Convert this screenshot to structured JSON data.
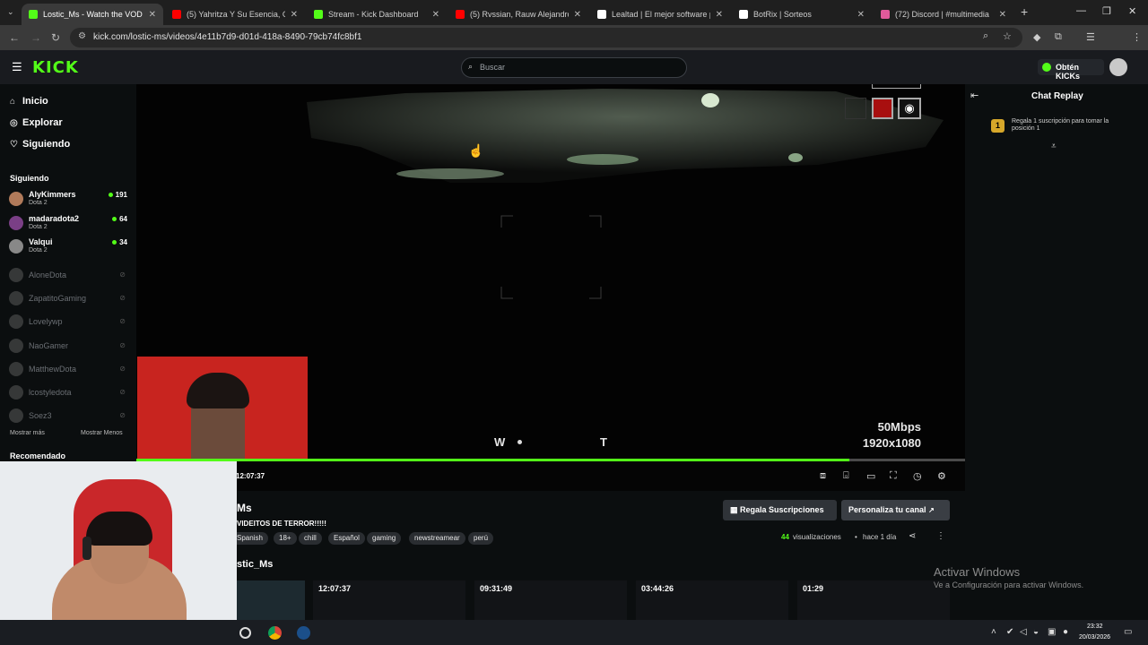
{
  "browser": {
    "tabs": [
      {
        "label": "Lostic_Ms - Watch the VOD on",
        "color": "#53fc18",
        "active": true
      },
      {
        "label": "(5) Yahritza Y Su Esencia, Grupo",
        "color": "#ff0000"
      },
      {
        "label": "Stream - Kick Dashboard",
        "color": "#53fc18"
      },
      {
        "label": "(5) Rvssian, Rauw Alejandro & L",
        "color": "#ff0000"
      },
      {
        "label": "Lealtad | El mejor software para",
        "color": "#ffffff"
      },
      {
        "label": "BotRix | Sorteos",
        "color": "#ffffff"
      },
      {
        "label": "(72) Discord | #multimedia",
        "color": "#e05a9b"
      }
    ],
    "new_tab": "+",
    "url": "kick.com/lostic-ms/videos/4e11b7d9-d01d-418a-8490-79cb74fc8bf1"
  },
  "header": {
    "logo": "KICK",
    "search_placeholder": "Buscar",
    "kicks_button": "Obtén KICKs"
  },
  "sidebar": {
    "nav": [
      {
        "label": "Inicio",
        "icon": "home-icon",
        "glyph": "⌂"
      },
      {
        "label": "Explorar",
        "icon": "compass-icon",
        "glyph": "◎"
      },
      {
        "label": "Siguiendo",
        "icon": "heart-icon",
        "glyph": "♡"
      }
    ],
    "following_heading": "Siguiendo",
    "live_channels": [
      {
        "name": "AlyKimmers",
        "game": "Dota 2",
        "viewers": "191",
        "color": "#b07a5a"
      },
      {
        "name": "madaradota2",
        "game": "Dota 2",
        "viewers": "64",
        "color": "#7a3f86"
      },
      {
        "name": "Valqui",
        "game": "Dota 2",
        "viewers": "34",
        "color": "#888888"
      }
    ],
    "offline_channels": [
      "AloneDota",
      "ZapatitoGaming",
      "Lovelywp",
      "NaoGamer",
      "MatthewDota",
      "lcostyledota",
      "Soez3"
    ],
    "show_more": "Mostrar más",
    "show_less": "Mostrar Menos",
    "recommended_heading": "Recomendado"
  },
  "video": {
    "bitrate": "50Mbps",
    "resolution": "1920x1080",
    "hud_left": "W",
    "hud_right": "T",
    "timestamp": "12:07:37",
    "progress": 0.86
  },
  "chat": {
    "title": "Chat Replay",
    "notice": "Regala 1 suscripción para tomar la posición 1",
    "rank": "1"
  },
  "stream_info": {
    "channel_name_partial": "Ms",
    "title_partial": "VIDEITOS DE TERROR!!!!!",
    "tags": [
      "Spanish",
      "18+",
      "chill",
      "Español",
      "gaming",
      "newstreamear",
      "perú"
    ],
    "gift_button": "Regala Suscripciones",
    "customize_button": "Personaliza tu canal",
    "views_count": "44",
    "views_label": "visualizaciones",
    "age": "hace 1 día",
    "more_videos_heading": "stic_Ms",
    "video_durations": [
      "12:07:37",
      "09:31:49",
      "03:44:26",
      "01:29"
    ]
  },
  "overlay": {
    "activate_title": "Activar Windows",
    "activate_sub": "Ve a Configuración para activar Windows."
  },
  "taskbar": {
    "time": "23:32",
    "date": "20/03/2026"
  }
}
